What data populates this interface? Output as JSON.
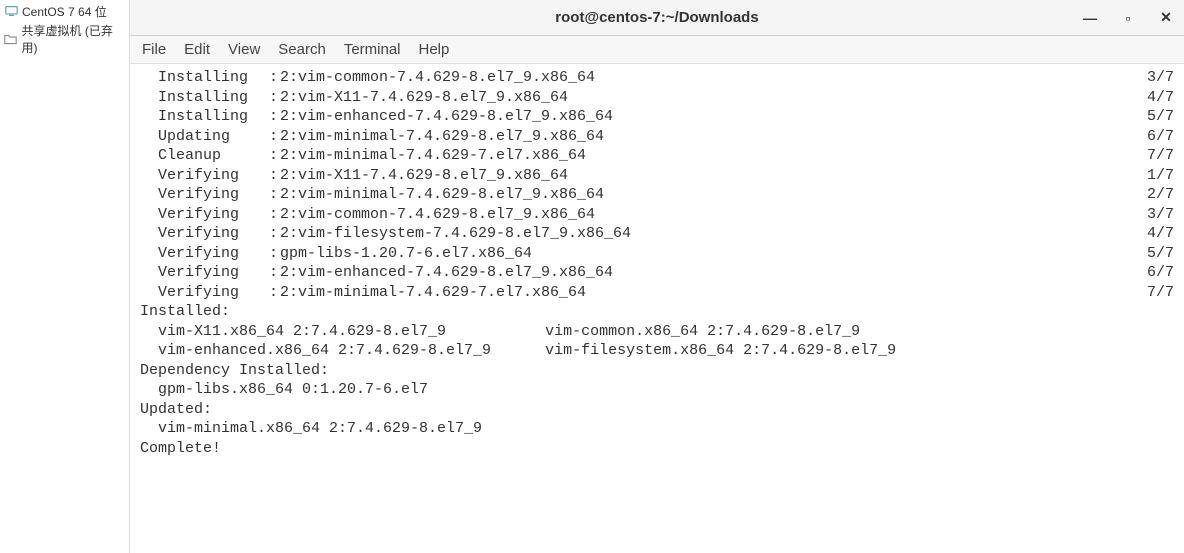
{
  "sidebar": {
    "items": [
      {
        "icon": "monitor",
        "label": "CentOS 7 64 位"
      },
      {
        "icon": "folder",
        "label": "共享虚拟机 (已弃用)"
      }
    ]
  },
  "window": {
    "title": "root@centos-7:~/Downloads",
    "controls": {
      "min": "—",
      "max": "▫",
      "close": "✕"
    }
  },
  "menubar": {
    "items": [
      "File",
      "Edit",
      "View",
      "Search",
      "Terminal",
      "Help"
    ]
  },
  "terminal": {
    "steps": [
      {
        "action": "  Installing",
        "sep": " : ",
        "pkg": "2:vim-common-7.4.629-8.el7_9.x86_64",
        "count": "3/7"
      },
      {
        "action": "  Installing",
        "sep": " : ",
        "pkg": "2:vim-X11-7.4.629-8.el7_9.x86_64",
        "count": "4/7"
      },
      {
        "action": "  Installing",
        "sep": " : ",
        "pkg": "2:vim-enhanced-7.4.629-8.el7_9.x86_64",
        "count": "5/7"
      },
      {
        "action": "  Updating  ",
        "sep": " : ",
        "pkg": "2:vim-minimal-7.4.629-8.el7_9.x86_64",
        "count": "6/7"
      },
      {
        "action": "  Cleanup   ",
        "sep": " : ",
        "pkg": "2:vim-minimal-7.4.629-7.el7.x86_64",
        "count": "7/7"
      },
      {
        "action": "  Verifying ",
        "sep": " : ",
        "pkg": "2:vim-X11-7.4.629-8.el7_9.x86_64",
        "count": "1/7"
      },
      {
        "action": "  Verifying ",
        "sep": " : ",
        "pkg": "2:vim-minimal-7.4.629-8.el7_9.x86_64",
        "count": "2/7"
      },
      {
        "action": "  Verifying ",
        "sep": " : ",
        "pkg": "2:vim-common-7.4.629-8.el7_9.x86_64",
        "count": "3/7"
      },
      {
        "action": "  Verifying ",
        "sep": " : ",
        "pkg": "2:vim-filesystem-7.4.629-8.el7_9.x86_64",
        "count": "4/7"
      },
      {
        "action": "  Verifying ",
        "sep": " : ",
        "pkg": "gpm-libs-1.20.7-6.el7.x86_64",
        "count": "5/7"
      },
      {
        "action": "  Verifying ",
        "sep": " : ",
        "pkg": "2:vim-enhanced-7.4.629-8.el7_9.x86_64",
        "count": "6/7"
      },
      {
        "action": "  Verifying ",
        "sep": " : ",
        "pkg": "2:vim-minimal-7.4.629-7.el7.x86_64",
        "count": "7/7"
      }
    ],
    "installed_header": "Installed:",
    "installed_line1": "  vim-X11.x86_64 2:7.4.629-8.el7_9           vim-common.x86_64 2:7.4.629-8.el7_9",
    "installed_line2": "  vim-enhanced.x86_64 2:7.4.629-8.el7_9      vim-filesystem.x86_64 2:7.4.629-8.el7_9",
    "dep_header": "Dependency Installed:",
    "dep_line": "  gpm-libs.x86_64 0:1.20.7-6.el7",
    "updated_header": "Updated:",
    "updated_line": "  vim-minimal.x86_64 2:7.4.629-8.el7_9",
    "complete": "Complete!"
  }
}
